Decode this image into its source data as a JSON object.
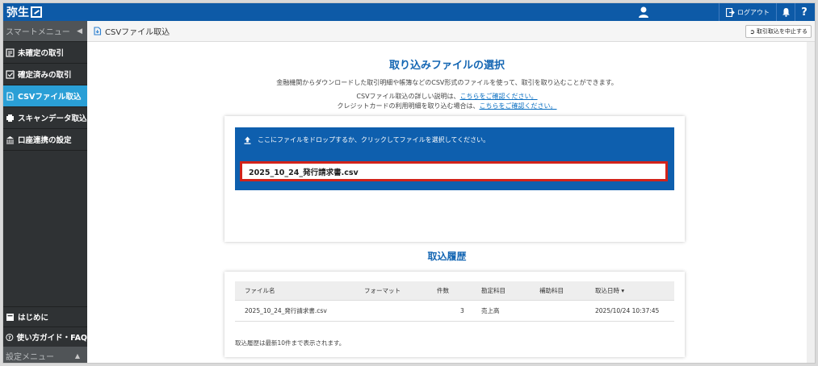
{
  "topbar": {
    "brand": "弥生",
    "logout_label": "ログアウト",
    "help_label": "?"
  },
  "sidebar": {
    "smart_menu_label": "スマートメニュー",
    "items": [
      {
        "label": "未確定の取引",
        "icon": "pending-icon"
      },
      {
        "label": "確定済みの取引",
        "icon": "confirmed-icon"
      },
      {
        "label": "CSVファイル取込",
        "icon": "csv-file-icon",
        "active": true
      },
      {
        "label": "スキャンデータ取込",
        "icon": "scan-icon"
      },
      {
        "label": "口座連携の設定",
        "icon": "bank-icon"
      }
    ],
    "bottom_items": [
      {
        "label": "はじめに",
        "icon": "book-icon"
      },
      {
        "label": "使い方ガイド・FAQ",
        "icon": "help-circle-icon"
      }
    ],
    "settings_menu_label": "設定メニュー"
  },
  "breadcrumb": {
    "title": "CSVファイル取込",
    "cancel_label": "取引取込を中止する"
  },
  "main": {
    "title": "取り込みファイルの選択",
    "desc1": "金融機関からダウンロードした取引明細や帳簿などのCSV形式のファイルを使って、取引を取り込むことができます。",
    "desc2_prefix": "CSVファイル取込の詳しい説明は、",
    "desc2_link": "こちらをご確認ください。",
    "desc3_prefix": "クレジットカードの利用明細を取り込む場合は、",
    "desc3_link": "こちらをご確認ください。",
    "dropzone_text": "ここにファイルをドロップするか、クリックしてファイルを選択してください。",
    "selected_file": "2025_10_24_発行請求書.csv"
  },
  "history": {
    "title": "取込履歴",
    "columns": {
      "file": "ファイル名",
      "format": "フォーマット",
      "count": "件数",
      "account": "勘定科目",
      "subaccount": "補助科目",
      "date": "取込日時 ▾"
    },
    "rows": [
      {
        "file": "2025_10_24_発行請求書.csv",
        "format": "",
        "count": "3",
        "account": "売上高",
        "subaccount": "",
        "date": "2025/10/24 10:37:45"
      }
    ],
    "note": "取込履歴は最新10件まで表示されます。"
  },
  "colors": {
    "brand_blue": "#0d5aa7",
    "active_item": "#2a9fd6",
    "highlight_border": "#d2231a"
  }
}
